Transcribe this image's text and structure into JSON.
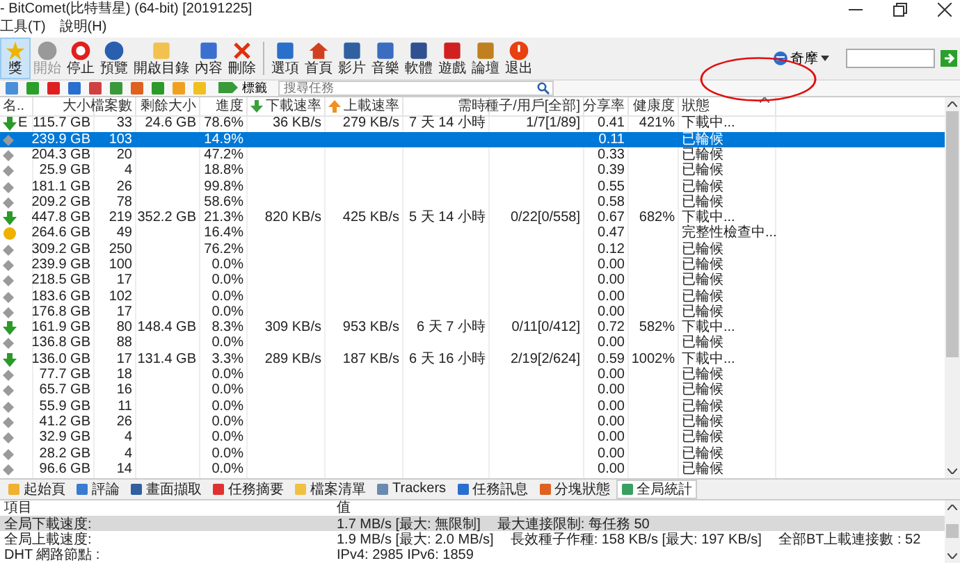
{
  "window": {
    "title": "- BitComet(比特彗星) (64-bit) [20191225]"
  },
  "menu": [
    "工具(T)",
    "說明(H)"
  ],
  "toolbar": [
    {
      "label": "獎",
      "selected": true,
      "disabled": false
    },
    {
      "label": "開始",
      "selected": false,
      "disabled": true
    },
    {
      "label": "停止",
      "selected": false,
      "disabled": false
    },
    {
      "label": "預覽",
      "selected": false,
      "disabled": false
    },
    {
      "label": "開啟目錄",
      "selected": false,
      "disabled": false
    },
    {
      "label": "內容",
      "selected": false,
      "disabled": false
    },
    {
      "label": "刪除",
      "selected": false,
      "disabled": false
    },
    {
      "label": "選項",
      "selected": false,
      "disabled": false
    },
    {
      "label": "首頁",
      "selected": false,
      "disabled": false
    },
    {
      "label": "影片",
      "selected": false,
      "disabled": false
    },
    {
      "label": "音樂",
      "selected": false,
      "disabled": false
    },
    {
      "label": "軟體",
      "selected": false,
      "disabled": false
    },
    {
      "label": "遊戲",
      "selected": false,
      "disabled": false
    },
    {
      "label": "論壇",
      "selected": false,
      "disabled": false
    },
    {
      "label": "退出",
      "selected": false,
      "disabled": false
    }
  ],
  "search_engine": {
    "label": "奇摩"
  },
  "tag_button": {
    "label": "標籤"
  },
  "task_search": {
    "placeholder": "搜尋任務"
  },
  "table": {
    "columns": [
      "名..",
      "大小",
      "檔案數",
      "剩餘大小",
      "進度",
      "下載速率",
      "上載速率",
      "需時",
      "種子/用戶[全部]",
      "分享率",
      "健康度",
      "狀態"
    ],
    "rows": [
      {
        "kind": "downloading",
        "selected": false,
        "cells": [
          "E",
          "115.7 GB",
          "33",
          "24.6 GB",
          "78.6%",
          "36 KB/s",
          "279 KB/s",
          "7 天 14 小時",
          "1/7[1/89]",
          "0.41",
          "421%",
          "下載中..."
        ]
      },
      {
        "kind": "queued",
        "selected": true,
        "cells": [
          "",
          "239.9 GB",
          "103",
          "",
          "14.9%",
          "",
          "",
          "",
          "",
          "0.11",
          "",
          "已輪候"
        ]
      },
      {
        "kind": "queued",
        "selected": false,
        "cells": [
          "",
          "204.3 GB",
          "20",
          "",
          "47.2%",
          "",
          "",
          "",
          "",
          "0.33",
          "",
          "已輪候"
        ]
      },
      {
        "kind": "queued",
        "selected": false,
        "cells": [
          "",
          "25.9 GB",
          "4",
          "",
          "18.8%",
          "",
          "",
          "",
          "",
          "0.39",
          "",
          "已輪候"
        ]
      },
      {
        "kind": "queued",
        "selected": false,
        "cells": [
          "",
          "181.1 GB",
          "26",
          "",
          "99.8%",
          "",
          "",
          "",
          "",
          "0.55",
          "",
          "已輪候"
        ]
      },
      {
        "kind": "queued",
        "selected": false,
        "cells": [
          "",
          "209.2 GB",
          "78",
          "",
          "58.6%",
          "",
          "",
          "",
          "",
          "0.58",
          "",
          "已輪候"
        ]
      },
      {
        "kind": "downloading",
        "selected": false,
        "cells": [
          "",
          "447.8 GB",
          "219",
          "352.2 GB",
          "21.3%",
          "820 KB/s",
          "425 KB/s",
          "5 天 14 小時",
          "0/22[0/558]",
          "0.67",
          "682%",
          "下載中..."
        ]
      },
      {
        "kind": "checking",
        "selected": false,
        "cells": [
          "",
          "264.6 GB",
          "49",
          "",
          "16.4%",
          "",
          "",
          "",
          "",
          "0.47",
          "",
          "完整性檢查中..."
        ]
      },
      {
        "kind": "queued",
        "selected": false,
        "cells": [
          "",
          "309.2 GB",
          "250",
          "",
          "76.2%",
          "",
          "",
          "",
          "",
          "0.12",
          "",
          "已輪候"
        ]
      },
      {
        "kind": "queued",
        "selected": false,
        "cells": [
          "",
          "239.9 GB",
          "100",
          "",
          "0.0%",
          "",
          "",
          "",
          "",
          "0.00",
          "",
          "已輪候"
        ]
      },
      {
        "kind": "queued",
        "selected": false,
        "cells": [
          "",
          "218.5 GB",
          "17",
          "",
          "0.0%",
          "",
          "",
          "",
          "",
          "0.00",
          "",
          "已輪候"
        ]
      },
      {
        "kind": "queued",
        "selected": false,
        "cells": [
          "",
          "183.6 GB",
          "102",
          "",
          "0.0%",
          "",
          "",
          "",
          "",
          "0.00",
          "",
          "已輪候"
        ]
      },
      {
        "kind": "queued",
        "selected": false,
        "cells": [
          "",
          "176.8 GB",
          "17",
          "",
          "0.0%",
          "",
          "",
          "",
          "",
          "0.00",
          "",
          "已輪候"
        ]
      },
      {
        "kind": "downloading",
        "selected": false,
        "cells": [
          "",
          "161.9 GB",
          "80",
          "148.4 GB",
          "8.3%",
          "309 KB/s",
          "953 KB/s",
          "6 天 7 小時",
          "0/11[0/412]",
          "0.72",
          "582%",
          "下載中..."
        ]
      },
      {
        "kind": "queued",
        "selected": false,
        "cells": [
          "",
          "136.8 GB",
          "88",
          "",
          "0.0%",
          "",
          "",
          "",
          "",
          "0.00",
          "",
          "已輪候"
        ]
      },
      {
        "kind": "downloading",
        "selected": false,
        "cells": [
          "",
          "136.0 GB",
          "17",
          "131.4 GB",
          "3.3%",
          "289 KB/s",
          "187 KB/s",
          "6 天 16 小時",
          "2/19[2/624]",
          "0.59",
          "1002%",
          "下載中..."
        ]
      },
      {
        "kind": "queued",
        "selected": false,
        "cells": [
          "",
          "77.7 GB",
          "18",
          "",
          "0.0%",
          "",
          "",
          "",
          "",
          "0.00",
          "",
          "已輪候"
        ]
      },
      {
        "kind": "queued",
        "selected": false,
        "cells": [
          "",
          "65.7 GB",
          "16",
          "",
          "0.0%",
          "",
          "",
          "",
          "",
          "0.00",
          "",
          "已輪候"
        ]
      },
      {
        "kind": "queued",
        "selected": false,
        "cells": [
          "",
          "55.9 GB",
          "11",
          "",
          "0.0%",
          "",
          "",
          "",
          "",
          "0.00",
          "",
          "已輪候"
        ]
      },
      {
        "kind": "queued",
        "selected": false,
        "cells": [
          "",
          "41.2 GB",
          "26",
          "",
          "0.0%",
          "",
          "",
          "",
          "",
          "0.00",
          "",
          "已輪候"
        ]
      },
      {
        "kind": "queued",
        "selected": false,
        "cells": [
          "",
          "32.9 GB",
          "4",
          "",
          "0.0%",
          "",
          "",
          "",
          "",
          "0.00",
          "",
          "已輪候"
        ]
      },
      {
        "kind": "queued",
        "selected": false,
        "cells": [
          "",
          "28.2 GB",
          "4",
          "",
          "0.0%",
          "",
          "",
          "",
          "",
          "0.00",
          "",
          "已輪候"
        ]
      },
      {
        "kind": "queued",
        "selected": false,
        "cells": [
          "",
          "96.6 GB",
          "14",
          "",
          "0.0%",
          "",
          "",
          "",
          "",
          "0.00",
          "",
          "已輪候"
        ]
      }
    ]
  },
  "bottom_tabs": [
    {
      "label": "起始頁",
      "selected": false
    },
    {
      "label": "評論",
      "selected": false
    },
    {
      "label": "畫面擷取",
      "selected": false
    },
    {
      "label": "任務摘要",
      "selected": false
    },
    {
      "label": "檔案清單",
      "selected": false
    },
    {
      "label": "Trackers",
      "selected": false
    },
    {
      "label": "任務訊息",
      "selected": false
    },
    {
      "label": "分塊狀態",
      "selected": false
    },
    {
      "label": "全局統計",
      "selected": true
    }
  ],
  "stats": {
    "columns": [
      "項目",
      "值"
    ],
    "rows": [
      {
        "selected": true,
        "item": "全局下載速度:",
        "values": [
          "1.7 MB/s [最大: 無限制]",
          "最大連接限制: 每任務 50"
        ]
      },
      {
        "selected": false,
        "item": "全局上載速度:",
        "values": [
          "1.9 MB/s [最大: 2.0 MB/s]",
          "長效種子作種: 158 KB/s [最大: 197 KB/s]",
          "全部BT上載連接數 : 52"
        ]
      },
      {
        "selected": false,
        "item": "DHT 網路節點 :",
        "values": [
          "IPv4: 2985  IPv6: 1859"
        ]
      }
    ]
  }
}
